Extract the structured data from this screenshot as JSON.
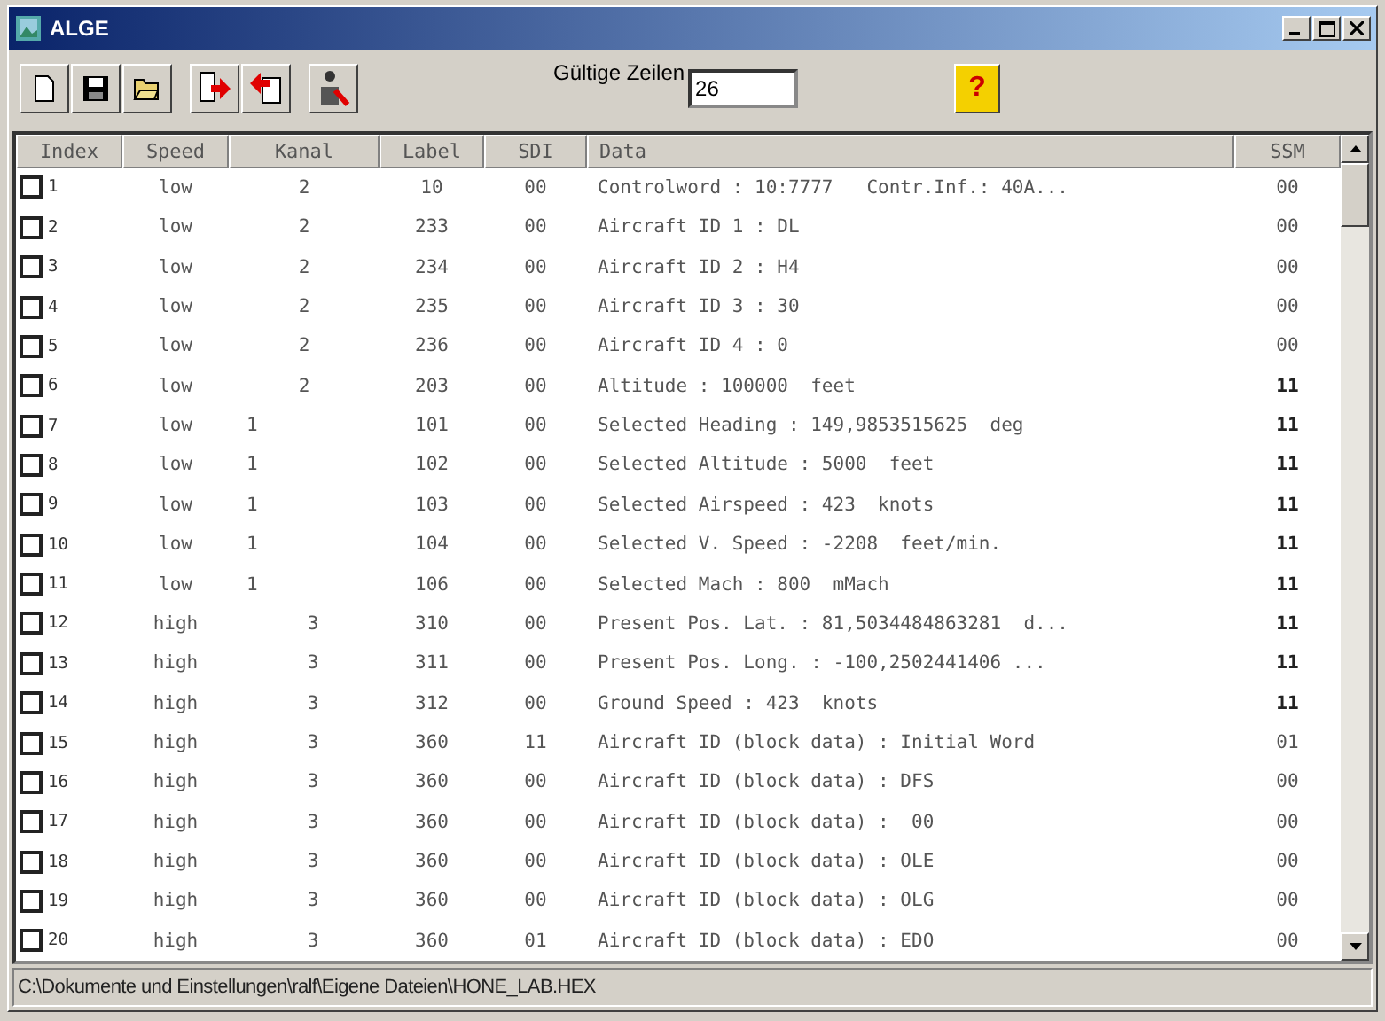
{
  "window": {
    "title": "ALGE"
  },
  "toolbar": {
    "valid_rows_label": "Gültige Zeilen",
    "valid_rows_value": "26",
    "help_button": "?"
  },
  "table": {
    "columns": [
      "Index",
      "Speed",
      "Kanal",
      "Label",
      "SDI",
      "Data",
      "SSM"
    ],
    "rows": [
      {
        "checked": false,
        "index": "1",
        "speed": "low",
        "kanal": "2",
        "label": "10",
        "sdi": "00",
        "data": "Controlword : 10:7777   Contr.Inf.: 40A...",
        "ssm": "00"
      },
      {
        "checked": false,
        "index": "2",
        "speed": "low",
        "kanal": "2",
        "label": "233",
        "sdi": "00",
        "data": "Aircraft ID 1 : DL",
        "ssm": "00"
      },
      {
        "checked": false,
        "index": "3",
        "speed": "low",
        "kanal": "2",
        "label": "234",
        "sdi": "00",
        "data": "Aircraft ID 2 : H4",
        "ssm": "00"
      },
      {
        "checked": false,
        "index": "4",
        "speed": "low",
        "kanal": "2",
        "label": "235",
        "sdi": "00",
        "data": "Aircraft ID 3 : 30",
        "ssm": "00"
      },
      {
        "checked": false,
        "index": "5",
        "speed": "low",
        "kanal": "2",
        "label": "236",
        "sdi": "00",
        "data": "Aircraft ID 4 : 0",
        "ssm": "00"
      },
      {
        "checked": false,
        "index": "6",
        "speed": "low",
        "kanal": "2",
        "label": "203",
        "sdi": "00",
        "data": "Altitude : 100000  feet",
        "ssm": "11"
      },
      {
        "checked": false,
        "index": "7",
        "speed": "low",
        "kanal": "1",
        "label": "101",
        "sdi": "00",
        "data": "Selected Heading : 149,9853515625  deg",
        "ssm": "11"
      },
      {
        "checked": false,
        "index": "8",
        "speed": "low",
        "kanal": "1",
        "label": "102",
        "sdi": "00",
        "data": "Selected Altitude : 5000  feet",
        "ssm": "11"
      },
      {
        "checked": false,
        "index": "9",
        "speed": "low",
        "kanal": "1",
        "label": "103",
        "sdi": "00",
        "data": "Selected Airspeed : 423  knots",
        "ssm": "11"
      },
      {
        "checked": false,
        "index": "10",
        "speed": "low",
        "kanal": "1",
        "label": "104",
        "sdi": "00",
        "data": "Selected V. Speed : -2208  feet/min.",
        "ssm": "11"
      },
      {
        "checked": false,
        "index": "11",
        "speed": "low",
        "kanal": "1",
        "label": "106",
        "sdi": "00",
        "data": "Selected Mach : 800  mMach",
        "ssm": "11"
      },
      {
        "checked": false,
        "index": "12",
        "speed": "high",
        "kanal": "3",
        "label": "310",
        "sdi": "00",
        "data": "Present Pos. Lat. : 81,5034484863281  d...",
        "ssm": "11"
      },
      {
        "checked": false,
        "index": "13",
        "speed": "high",
        "kanal": "3",
        "label": "311",
        "sdi": "00",
        "data": "Present Pos. Long. : -100,2502441406 ...",
        "ssm": "11"
      },
      {
        "checked": false,
        "index": "14",
        "speed": "high",
        "kanal": "3",
        "label": "312",
        "sdi": "00",
        "data": "Ground Speed : 423  knots",
        "ssm": "11"
      },
      {
        "checked": false,
        "index": "15",
        "speed": "high",
        "kanal": "3",
        "label": "360",
        "sdi": "11",
        "data": "Aircraft ID (block data) : Initial Word",
        "ssm": "01"
      },
      {
        "checked": false,
        "index": "16",
        "speed": "high",
        "kanal": "3",
        "label": "360",
        "sdi": "00",
        "data": "Aircraft ID (block data) : DFS",
        "ssm": "00"
      },
      {
        "checked": false,
        "index": "17",
        "speed": "high",
        "kanal": "3",
        "label": "360",
        "sdi": "00",
        "data": "Aircraft ID (block data) :  00",
        "ssm": "00"
      },
      {
        "checked": false,
        "index": "18",
        "speed": "high",
        "kanal": "3",
        "label": "360",
        "sdi": "00",
        "data": "Aircraft ID (block data) : OLE",
        "ssm": "00"
      },
      {
        "checked": false,
        "index": "19",
        "speed": "high",
        "kanal": "3",
        "label": "360",
        "sdi": "00",
        "data": "Aircraft ID (block data) : OLG",
        "ssm": "00"
      },
      {
        "checked": false,
        "index": "20",
        "speed": "high",
        "kanal": "3",
        "label": "360",
        "sdi": "01",
        "data": "Aircraft ID (block data) : EDO",
        "ssm": "00"
      }
    ]
  },
  "status_bar": {
    "path": "C:\\Dokumente und Einstellungen\\ralf\\Eigene Dateien\\HONE_LAB.HEX"
  }
}
